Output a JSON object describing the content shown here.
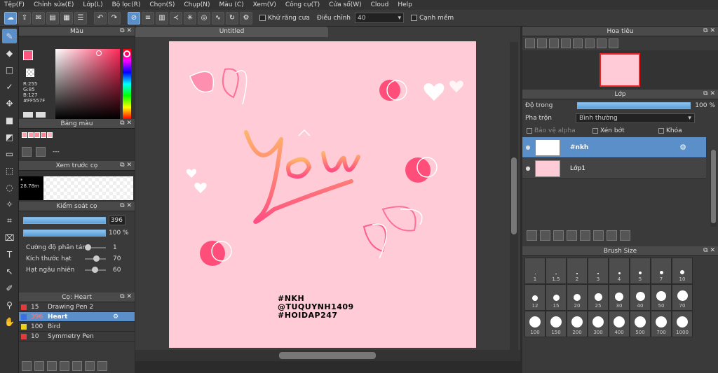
{
  "menu": [
    "Tệp(F)",
    "Chỉnh sửa(E)",
    "Lớp(L)",
    "Bộ lọc(R)",
    "Chọn(S)",
    "Chụp(N)",
    "Màu (C)",
    "Xem(V)",
    "Công cụ(T)",
    "Cửa sổ(W)",
    "Cloud",
    "Help"
  ],
  "toolbar": {
    "antialias_label": "Khử răng cưa",
    "adjust_label": "Điều chỉnh",
    "adjust_value": "40",
    "soft_edge_label": "Cạnh mềm"
  },
  "color_panel": {
    "title": "Màu",
    "rgb": "R:255\nG:85\nB:127\n#FF557F",
    "fg_color": "#ff557f"
  },
  "palette_panel": {
    "title": "Bảng màu",
    "swatches": [
      "#f4a2ad",
      "#ff9aa8",
      "#f78e9b",
      "#ff7f8f",
      "#ffb3bc"
    ],
    "dash": "---"
  },
  "brush_preview_panel": {
    "title": "Xem trước cọ",
    "size_label": "* 28.78m"
  },
  "brush_control_panel": {
    "title": "Kiểm soát cọ",
    "size_value": "396",
    "opacity_value": "100 %",
    "params": [
      {
        "label": "Cường độ phân tán",
        "value": "1"
      },
      {
        "label": "Kích thước hạt",
        "value": "70"
      },
      {
        "label": "Hạt ngẫu nhiên",
        "value": "60"
      }
    ]
  },
  "brush_list_panel": {
    "title": "Cọ: Heart",
    "items": [
      {
        "size": "15",
        "name": "Drawing Pen 2",
        "color": "#e23b3b"
      },
      {
        "size": "396",
        "name": "Heart",
        "color": "#3b6fe2"
      },
      {
        "size": "100",
        "name": "Bird",
        "color": "#e8d21f"
      },
      {
        "size": "10",
        "name": "Symmetry Pen",
        "color": "#e23b3b"
      }
    ]
  },
  "document": {
    "tab_title": "Untitled",
    "artwork_text": "yêu",
    "signature": [
      "#NKH",
      "@TUQUYNH1409",
      "#HOIDAP247"
    ]
  },
  "navigator_panel": {
    "title": "Hoa tiêu"
  },
  "layer_panel": {
    "title": "Lớp",
    "opacity_label": "Độ trong",
    "opacity_value": "100 %",
    "blend_label": "Pha trộn",
    "blend_value": "Bình thường",
    "protect_alpha": "Bảo vệ alpha",
    "clipping": "Xén bớt",
    "lock": "Khóa",
    "layers": [
      {
        "name": "#nkh",
        "selected": true
      },
      {
        "name": "Lớp1",
        "selected": false
      }
    ]
  },
  "brush_size_panel": {
    "title": "Brush Size",
    "sizes": [
      "1",
      "1.5",
      "2",
      "3",
      "4",
      "5",
      "7",
      "10",
      "12",
      "15",
      "20",
      "25",
      "30",
      "40",
      "50",
      "70",
      "100",
      "150",
      "200",
      "300",
      "400",
      "500",
      "700",
      "1000"
    ]
  }
}
